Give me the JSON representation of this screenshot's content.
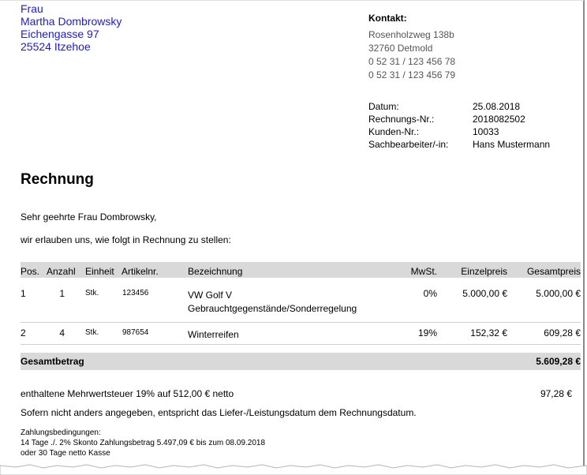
{
  "recipient": {
    "salutation": "Frau",
    "name": "Martha Dombrowsky",
    "street": "Eichengasse 97",
    "city": "25524 Itzehoe"
  },
  "contact": {
    "heading": "Kontakt:",
    "street": "Rosenholzweg 138b",
    "city": "32760 Detmold",
    "phone1": "0 52 31 / 123 456 78",
    "phone2": "0 52 31 / 123 456 79"
  },
  "meta": [
    {
      "key": "Datum:",
      "value": "25.08.2018"
    },
    {
      "key": "Rechnungs-Nr.:",
      "value": "2018082502"
    },
    {
      "key": "Kunden-Nr.:",
      "value": "10033"
    },
    {
      "key": "Sachbearbeiter/-in:",
      "value": "Hans Mustermann"
    }
  ],
  "title": "Rechnung",
  "salutation_text": "Sehr geehrte Frau Dombrowsky,",
  "intro_text": "wir erlauben uns, wie folgt in Rechnung zu stellen:",
  "table": {
    "headers": {
      "pos": "Pos.",
      "qty": "Anzahl",
      "unit": "Einheit",
      "article": "Artikelnr.",
      "desc": "Bezeichnung",
      "vat": "MwSt.",
      "unit_price": "Einzelpreis",
      "total": "Gesamtpreis"
    },
    "rows": [
      {
        "pos": "1",
        "qty": "1",
        "unit": "Stk.",
        "article": "123456",
        "desc": "VW Golf V",
        "desc2": "Gebrauchtgegenstände/Sonderregelung",
        "vat": "0%",
        "unit_price": "5.000,00 €",
        "total": "5.000,00 €"
      },
      {
        "pos": "2",
        "qty": "4",
        "unit": "Stk.",
        "article": "987654",
        "desc": "Winterreifen",
        "desc2": "",
        "vat": "19%",
        "unit_price": "152,32 €",
        "total": "609,28 €"
      }
    ]
  },
  "total": {
    "label": "Gesamtbetrag",
    "value": "5.609,28 €"
  },
  "vat_line": {
    "text": "enthaltene Mehrwertsteuer 19% auf 512,00 € netto",
    "value": "97,28 €"
  },
  "service_text": "Sofern nicht anders angegeben, entspricht das Liefer-/Leistungsdatum dem Rechnungsdatum.",
  "terms": {
    "heading": "Zahlungsbedingungen:",
    "line1": "14 Tage ./. 2% Skonto Zahlungsbetrag 5.497,09 € bis zum 08.09.2018",
    "line2": "oder 30 Tage netto Kasse"
  },
  "colors": {
    "recipient": "#1a1adb",
    "header_band": "#d9d9d9"
  }
}
